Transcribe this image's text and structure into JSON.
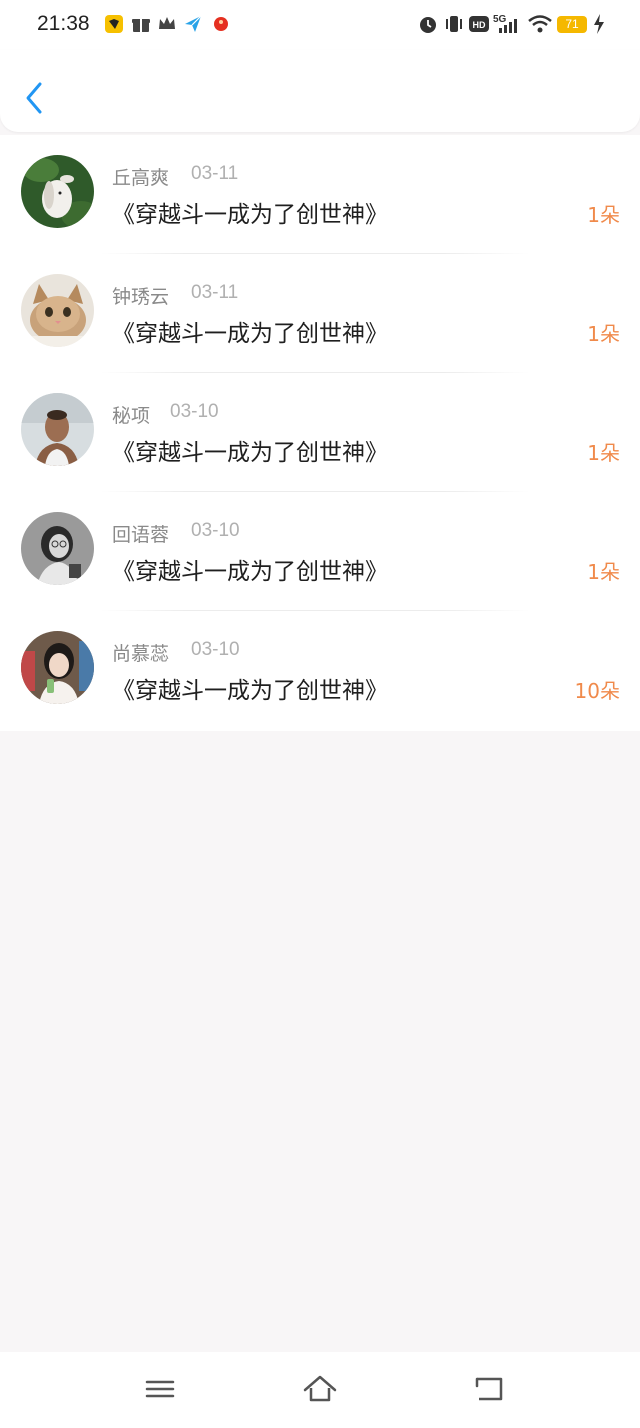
{
  "status_bar": {
    "time": "21:38",
    "battery": "71",
    "network": "5G",
    "hd": "HD",
    "notification_icons": [
      "app-icon-yellow",
      "gift-icon",
      "crown-icon",
      "send-icon",
      "red-dot-icon"
    ],
    "system_icons": [
      "alarm-icon",
      "vibrate-icon",
      "hd-icon",
      "signal-icon",
      "wifi-icon",
      "battery-icon",
      "charging-icon"
    ]
  },
  "header": {
    "back_icon": "chevron-left-icon",
    "accent": "#2196f3"
  },
  "list": {
    "items": [
      {
        "name": "丘高爽",
        "date": "03-11",
        "book": "《穿越斗一成为了创世神》",
        "count": "1朵",
        "avatar": "rabbit"
      },
      {
        "name": "钟琇云",
        "date": "03-11",
        "book": "《穿越斗一成为了创世神》",
        "count": "1朵",
        "avatar": "kitten"
      },
      {
        "name": "秘项",
        "date": "03-10",
        "book": "《穿越斗一成为了创世神》",
        "count": "1朵",
        "avatar": "man"
      },
      {
        "name": "回语蓉",
        "date": "03-10",
        "book": "《穿越斗一成为了创世神》",
        "count": "1朵",
        "avatar": "woman-bw"
      },
      {
        "name": "尚慕蕊",
        "date": "03-10",
        "book": "《穿越斗一成为了创世神》",
        "count": "10朵",
        "avatar": "girl"
      }
    ]
  },
  "colors": {
    "count": "#f08a4b",
    "name": "#8a8a8a",
    "book": "#1f1f1f",
    "background": "#f8f6f7"
  },
  "nav_bar": {
    "icons": [
      "menu-icon",
      "home-icon",
      "back-icon"
    ]
  }
}
